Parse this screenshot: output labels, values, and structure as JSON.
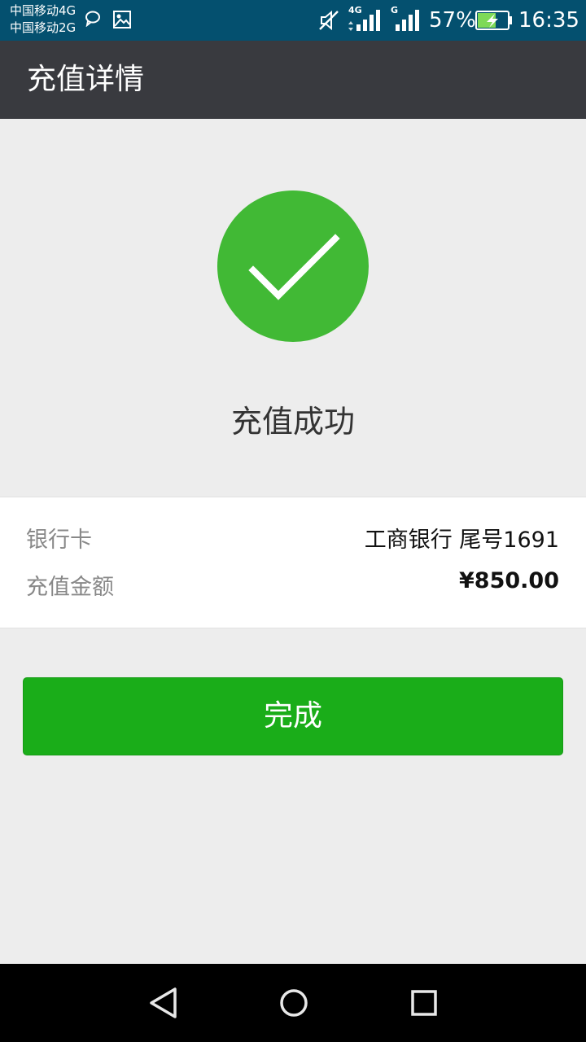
{
  "status_bar": {
    "carrier_1": "中国移动4G",
    "carrier_2": "中国移动2G",
    "network_1": "4G",
    "network_2": "G",
    "battery": "57%",
    "time": "16:35"
  },
  "header": {
    "title": "充值详情"
  },
  "result": {
    "message": "充值成功",
    "icon": "check-icon",
    "color": "#41b935"
  },
  "details": [
    {
      "label": "银行卡",
      "value": "工商银行 尾号1691"
    },
    {
      "label": "充值金额",
      "value": "¥850.00"
    }
  ],
  "actions": {
    "done_label": "完成",
    "color": "#1aad19"
  },
  "theme": {
    "status_bar": "#04506f",
    "title_bar": "#393a3f",
    "background": "#ededed"
  }
}
